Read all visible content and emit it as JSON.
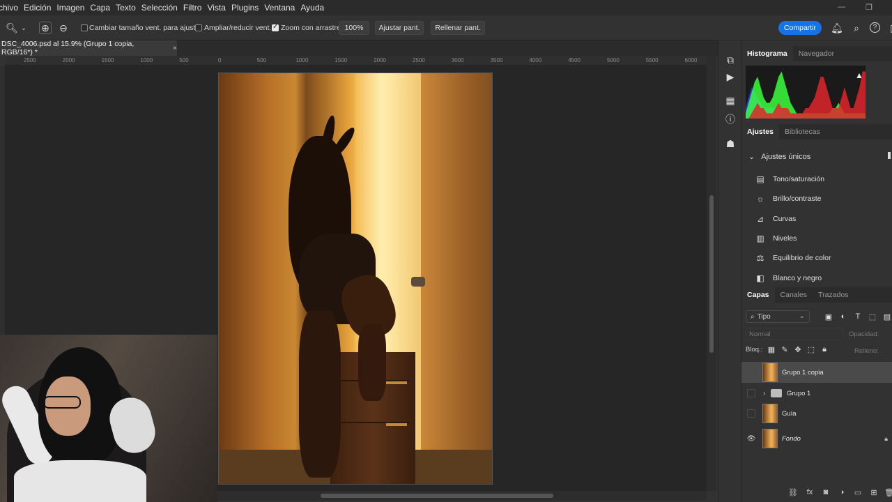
{
  "menu": [
    "chivo",
    "Edición",
    "Imagen",
    "Capa",
    "Texto",
    "Selección",
    "Filtro",
    "Vista",
    "Plugins",
    "Ventana",
    "Ayuda"
  ],
  "options": {
    "resize_windows": "Cambiar tamaño vent. para ajustar",
    "zoom_all": "Ampliar/reducir vent.",
    "scrubby_zoom": "Zoom con arrastre",
    "zoom_value": "100%",
    "fit_screen": "Ajustar pant.",
    "fill_screen": "Rellenar pant.",
    "share": "Compartir"
  },
  "document": {
    "tab_title": "DSC_4006.psd al 15.9% (Grupo 1 copia, RGB/16*) *"
  },
  "ruler_labels": [
    "2500",
    "2000",
    "1500",
    "1000",
    "500",
    "0",
    "500",
    "1000",
    "1500",
    "2000",
    "2500",
    "3000",
    "3500",
    "4000",
    "4500",
    "5000",
    "5500",
    "6000"
  ],
  "panels": {
    "top_tabs": [
      "Histograma",
      "Navegador"
    ],
    "adj_tabs": [
      "Ajustes",
      "Bibliotecas"
    ],
    "adj_section": "Ajustes únicos",
    "adjustments": [
      {
        "label": "Tono/saturación",
        "icon": "hue-icon"
      },
      {
        "label": "Brillo/contraste",
        "icon": "brightness-icon"
      },
      {
        "label": "Curvas",
        "icon": "curves-icon"
      },
      {
        "label": "Niveles",
        "icon": "levels-icon"
      },
      {
        "label": "Equilibrio de color",
        "icon": "color-balance-icon"
      },
      {
        "label": "Blanco y negro",
        "icon": "black-white-icon"
      }
    ],
    "layer_tabs": [
      "Capas",
      "Canales",
      "Trazados"
    ],
    "filter_kind": "Tipo",
    "blend_mode": "Normal",
    "opacity_label": "Opacidad:",
    "lock_label": "Bloq.:",
    "fill_label": "Relleno:",
    "layers": [
      {
        "name": "Grupo 1 copia",
        "selected": true,
        "visible": false
      },
      {
        "name": "Grupo 1",
        "group": true,
        "visible": false
      },
      {
        "name": "Guía",
        "visible": false
      },
      {
        "name": "Fondo",
        "visible": true,
        "italic": true,
        "locked": true
      }
    ]
  },
  "colors": {
    "accent": "#1473e6",
    "bg": "#323232",
    "canvas": "#262626"
  },
  "histogram": {
    "red": [
      0,
      0,
      1,
      2,
      3,
      2,
      2,
      1,
      1,
      1,
      2,
      3,
      2,
      2,
      2,
      1,
      1,
      1,
      1,
      1,
      2,
      2,
      3,
      4,
      6,
      8,
      8,
      6,
      4,
      2,
      2,
      2,
      4,
      6,
      4,
      2,
      2,
      4,
      6,
      9,
      9
    ],
    "green": [
      1,
      3,
      5,
      7,
      8,
      6,
      4,
      3,
      3,
      4,
      6,
      8,
      9,
      7,
      5,
      3,
      2,
      1,
      1,
      1,
      1,
      1,
      1,
      1,
      1,
      1,
      1,
      1,
      1,
      2,
      2,
      3,
      2,
      1,
      1,
      1,
      1,
      1,
      1,
      1,
      1
    ],
    "blue": [
      2,
      4,
      6,
      5,
      4,
      3,
      2,
      2,
      2,
      2,
      2,
      3,
      2,
      1,
      1,
      1,
      1,
      1,
      1,
      1,
      0,
      0,
      0,
      0,
      0,
      0,
      0,
      0,
      0,
      0,
      0,
      0,
      0,
      0,
      0,
      0,
      0,
      0,
      0,
      0,
      0
    ]
  }
}
